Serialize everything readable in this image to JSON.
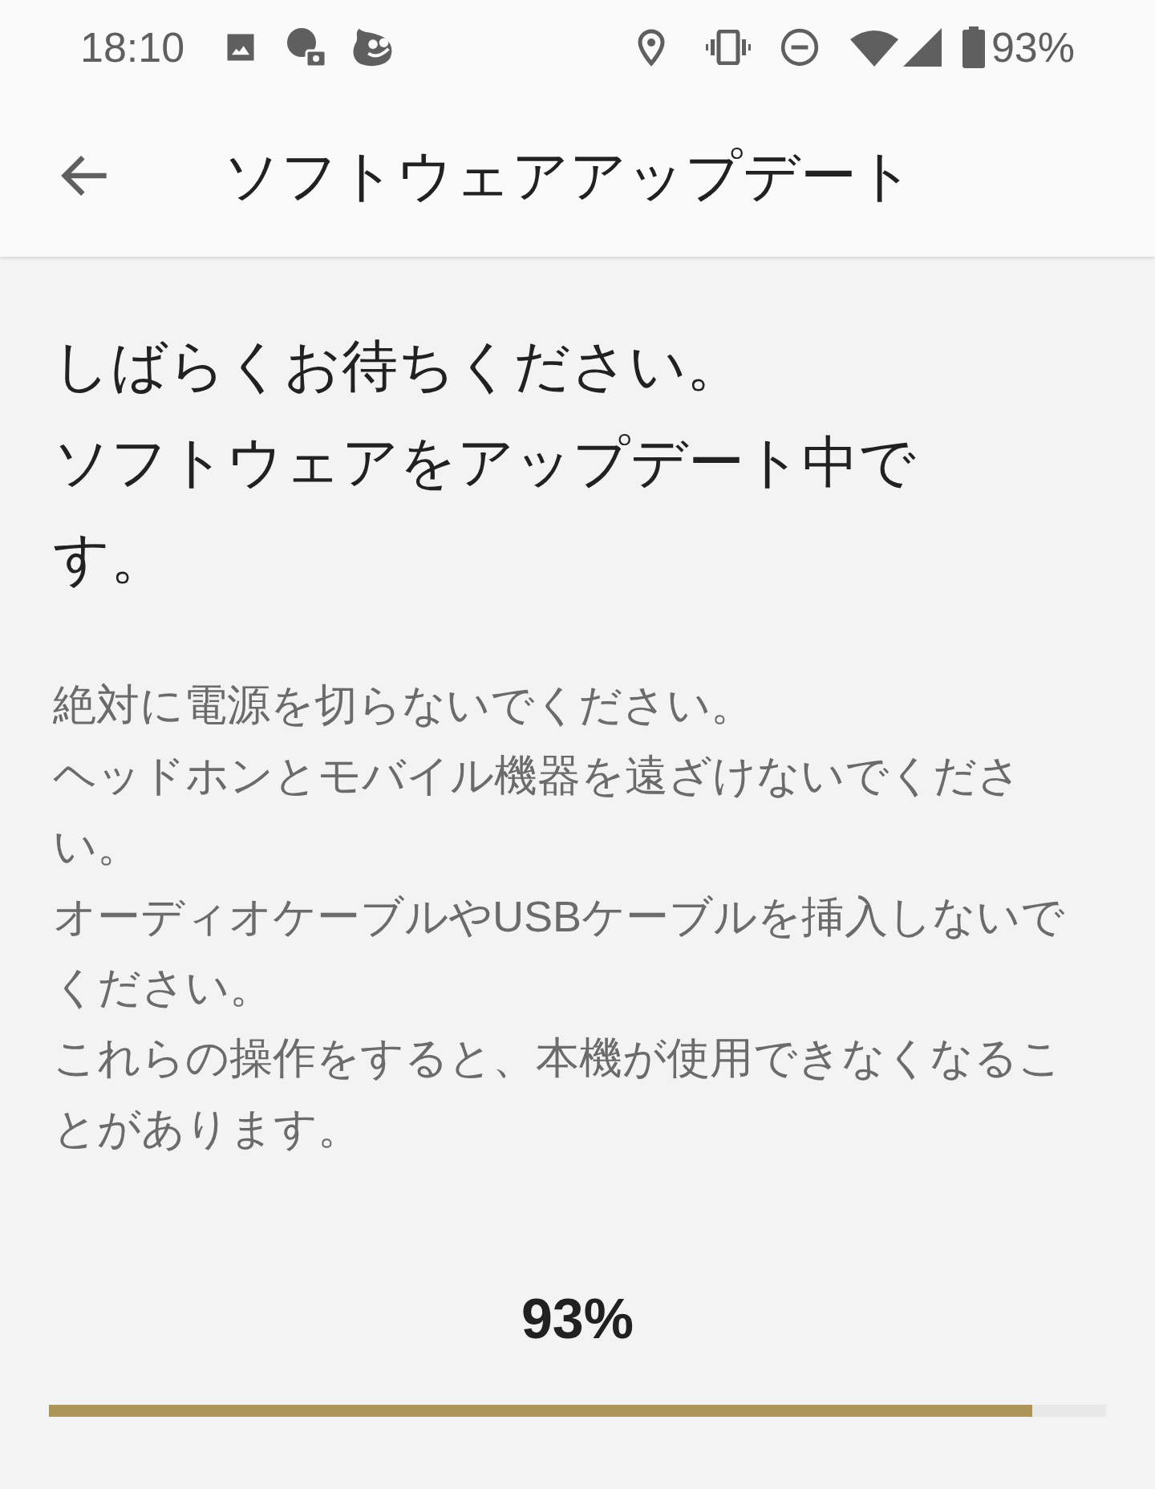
{
  "status_bar": {
    "time": "18:10",
    "battery": "93%"
  },
  "app_bar": {
    "title": "ソフトウェアアップデート"
  },
  "heading": [
    "しばらくお待ちください。",
    "ソフトウェアをアップデート中です。"
  ],
  "warnings": [
    "絶対に電源を切らないでください。",
    "ヘッドホンとモバイル機器を遠ざけないでください。",
    "オーディオケーブルやUSBケーブルを挿入しないでください。",
    "これらの操作をすると、本機が使用できなくなることがあります。"
  ],
  "progress": {
    "reading": "93%",
    "level": 0.93
  }
}
